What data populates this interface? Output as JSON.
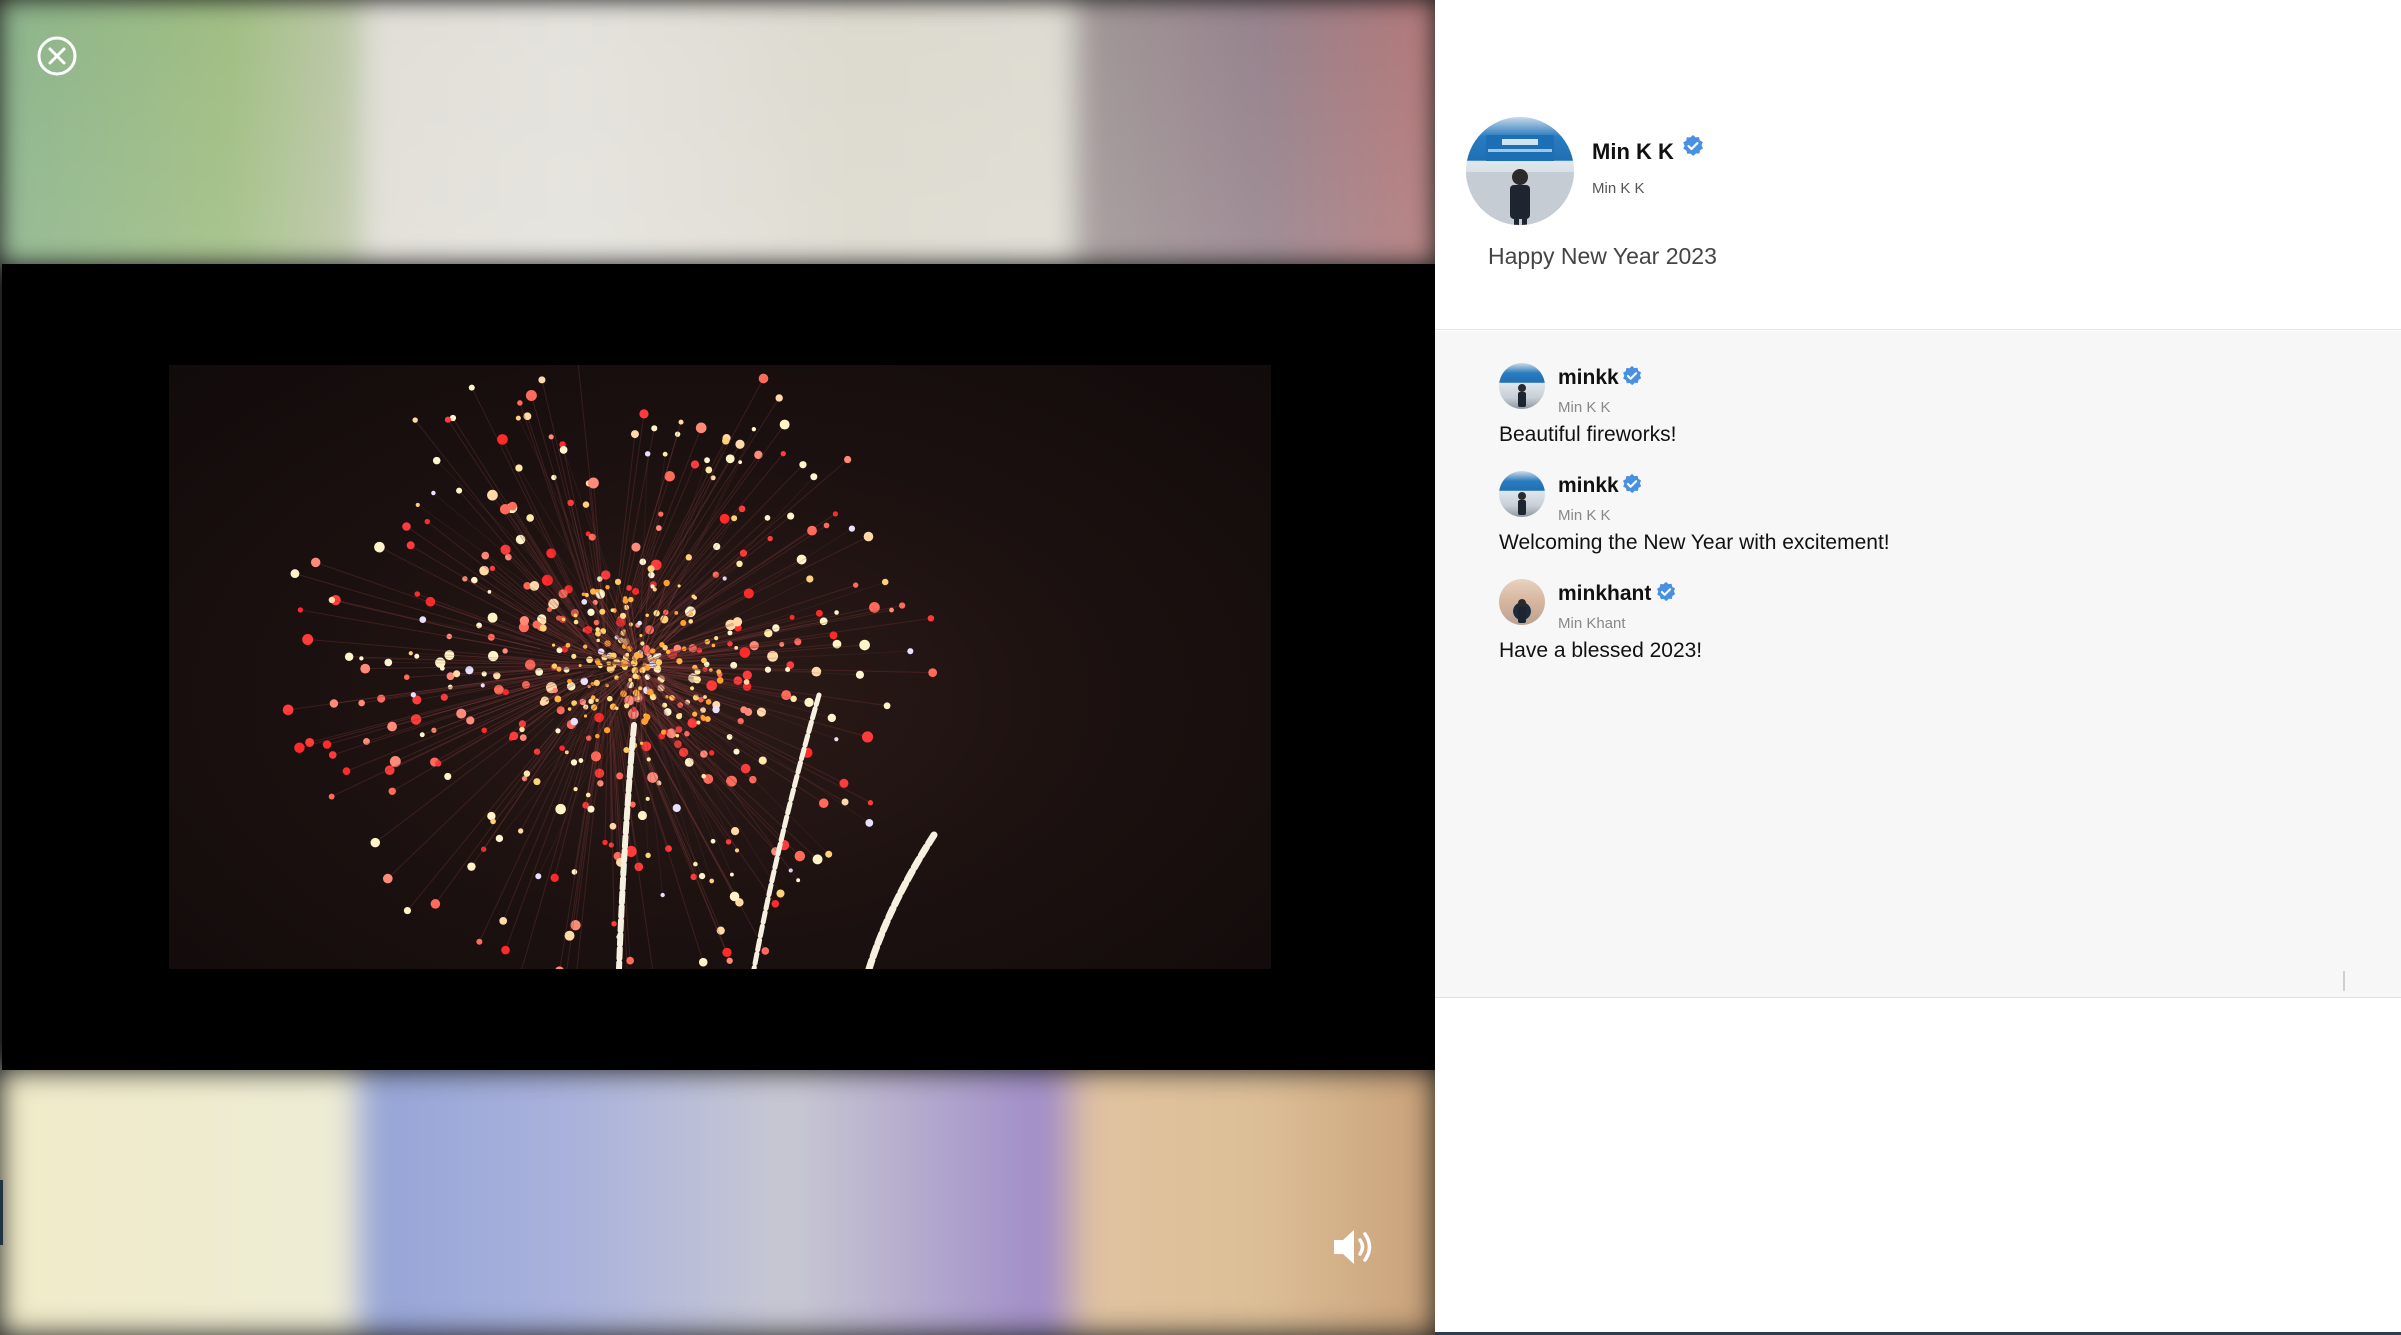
{
  "viewer": {
    "close_icon": "close-circle-icon",
    "volume_icon": "volume-icon",
    "media_alt": "fireworks video"
  },
  "post": {
    "author_name": "Min K K",
    "author_handle": "Min K K",
    "verified_icon": "verified-badge-icon",
    "text": "Happy New Year 2023"
  },
  "comments": [
    {
      "name": "minkk",
      "handle": "Min K K",
      "text": "Beautiful fireworks!"
    },
    {
      "name": "minkk",
      "handle": "Min K K",
      "text": "Welcoming the New Year with excitement!"
    },
    {
      "name": "minkhant",
      "handle": "Min Khant",
      "text": "Have a blessed 2023!"
    }
  ],
  "colors": {
    "verified": "#4a90e2",
    "panel_bg": "#ffffff",
    "comments_bg": "#f7f7f7"
  }
}
